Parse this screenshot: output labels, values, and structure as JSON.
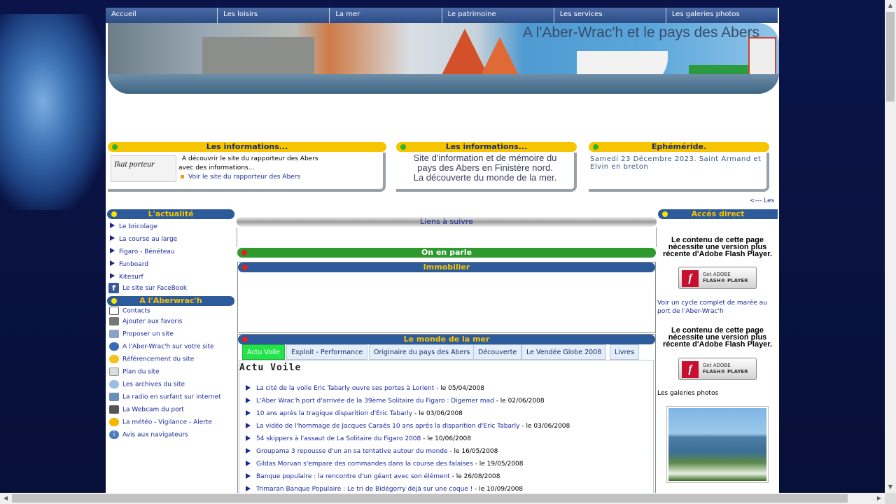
{
  "nav": [
    "Accueil",
    "Les loisirs",
    "La mer",
    "Le patrimoine",
    "Les services",
    "Les galeries photos"
  ],
  "banner": {
    "title": "A l'Aber-Wrac'h et le pays des Abers"
  },
  "info1": {
    "title": "Les informations...",
    "text1": "A découvrir le site du rapporteur des Abers",
    "text2": "avec des informations...",
    "link": "Voir le site du rapporteur des Abers"
  },
  "info2": {
    "title": "Les informations...",
    "line1": "Site d'information et de mémoire du",
    "line2": "pays des Abers en Finistère nord.",
    "line3": "La découverte du monde de la mer."
  },
  "ephem": {
    "title": "Ephéméride.",
    "text": "Samedi 23 Décembre 2023. Saint Armand et Elvin en breton"
  },
  "back_link": "<--- Les",
  "actualite": {
    "title": "L'actualité",
    "items": [
      "Le bricolage",
      "La course au large",
      "Figaro - Bénéteau",
      "Funboard",
      "Kitesurf"
    ],
    "facebook": "Le site sur FaceBook"
  },
  "aberwrach": {
    "title": "A l'Aberwrac'h",
    "items": [
      "Contacts",
      "Ajouter aux favoris",
      "Proposer un site",
      "A l'Aber-Wrac'h sur votre site",
      "Référencement du site",
      "Plan du site",
      "Les archives du site",
      "La radio en surfant sur internet",
      "La Webcam du port",
      "La météo - Vigilance - Alerte",
      "Avis aux navigateurs"
    ]
  },
  "center": {
    "liens": "Liens à suivre",
    "on_en_parle": "On en parle",
    "immobilier": "Immobilier",
    "monde_mer": "Le monde de la mer"
  },
  "tabs": [
    "Actu Voile",
    "Exploit - Performance",
    "Originaire du pays des Abers",
    "Découverte",
    "Le Vendée Globe 2008",
    "Livres"
  ],
  "actu": {
    "title": "Actu Voile",
    "items": [
      {
        "link": "La cité de la voile Eric Tabarly ouvre ses portes à Lorient",
        "date": " - le 05/04/2008"
      },
      {
        "link": "L'Aber Wrac'h port d'arrivée de la 39ème Solitaire du Figaro : Digemer mad",
        "date": " - le 02/06/2008"
      },
      {
        "link": "10 ans après la tragique disparition d'Eric Tabarly",
        "date": " - le 03/06/2008"
      },
      {
        "link": "La vidéo de l'hommage de Jacques Caraës 10 ans après la disparition d'Eric Tabarly",
        "date": " - le 03/06/2008"
      },
      {
        "link": "54 skippers à l'assaut de La Solitaire du Figaro 2008",
        "date": " - le 10/06/2008"
      },
      {
        "link": "Groupama 3 repousse d'un an sa tentative autour du monde",
        "date": " - le 16/05/2008"
      },
      {
        "link": "Gildas Morvan s'empare des commandes dans la course des falaises",
        "date": " - le 19/05/2008"
      },
      {
        "link": "Banque populaire : la rencontre d'un géant avec son élément",
        "date": " - le 26/08/2008"
      },
      {
        "link": "Trimaran Banque Populaire : Le tri de Bidégorry déjà sur une coque !",
        "date": " - le 10/09/2008"
      }
    ]
  },
  "right": {
    "title": "Accés direct",
    "flash_msg1": "Le contenu de cette page nécessite une version plus récente d'Adobe Flash Player.",
    "flash_get": "Get ADOBE",
    "flash_player": "FLASH® PLAYER",
    "tide_link": "Voir un cycle complet de marée au port de l'Aber-Wrac'h",
    "flash_msg2": "Le contenu de cette page nécessite une version plus récente d'Adobe Flash Player.",
    "galeries": "Les galeries photos"
  },
  "colors": {
    "nav": "#32558f",
    "yellow": "#f7c400",
    "blue_bar": "#2c5a9a",
    "green_bar": "#2e9a2e",
    "active_tab": "#22e44a"
  }
}
